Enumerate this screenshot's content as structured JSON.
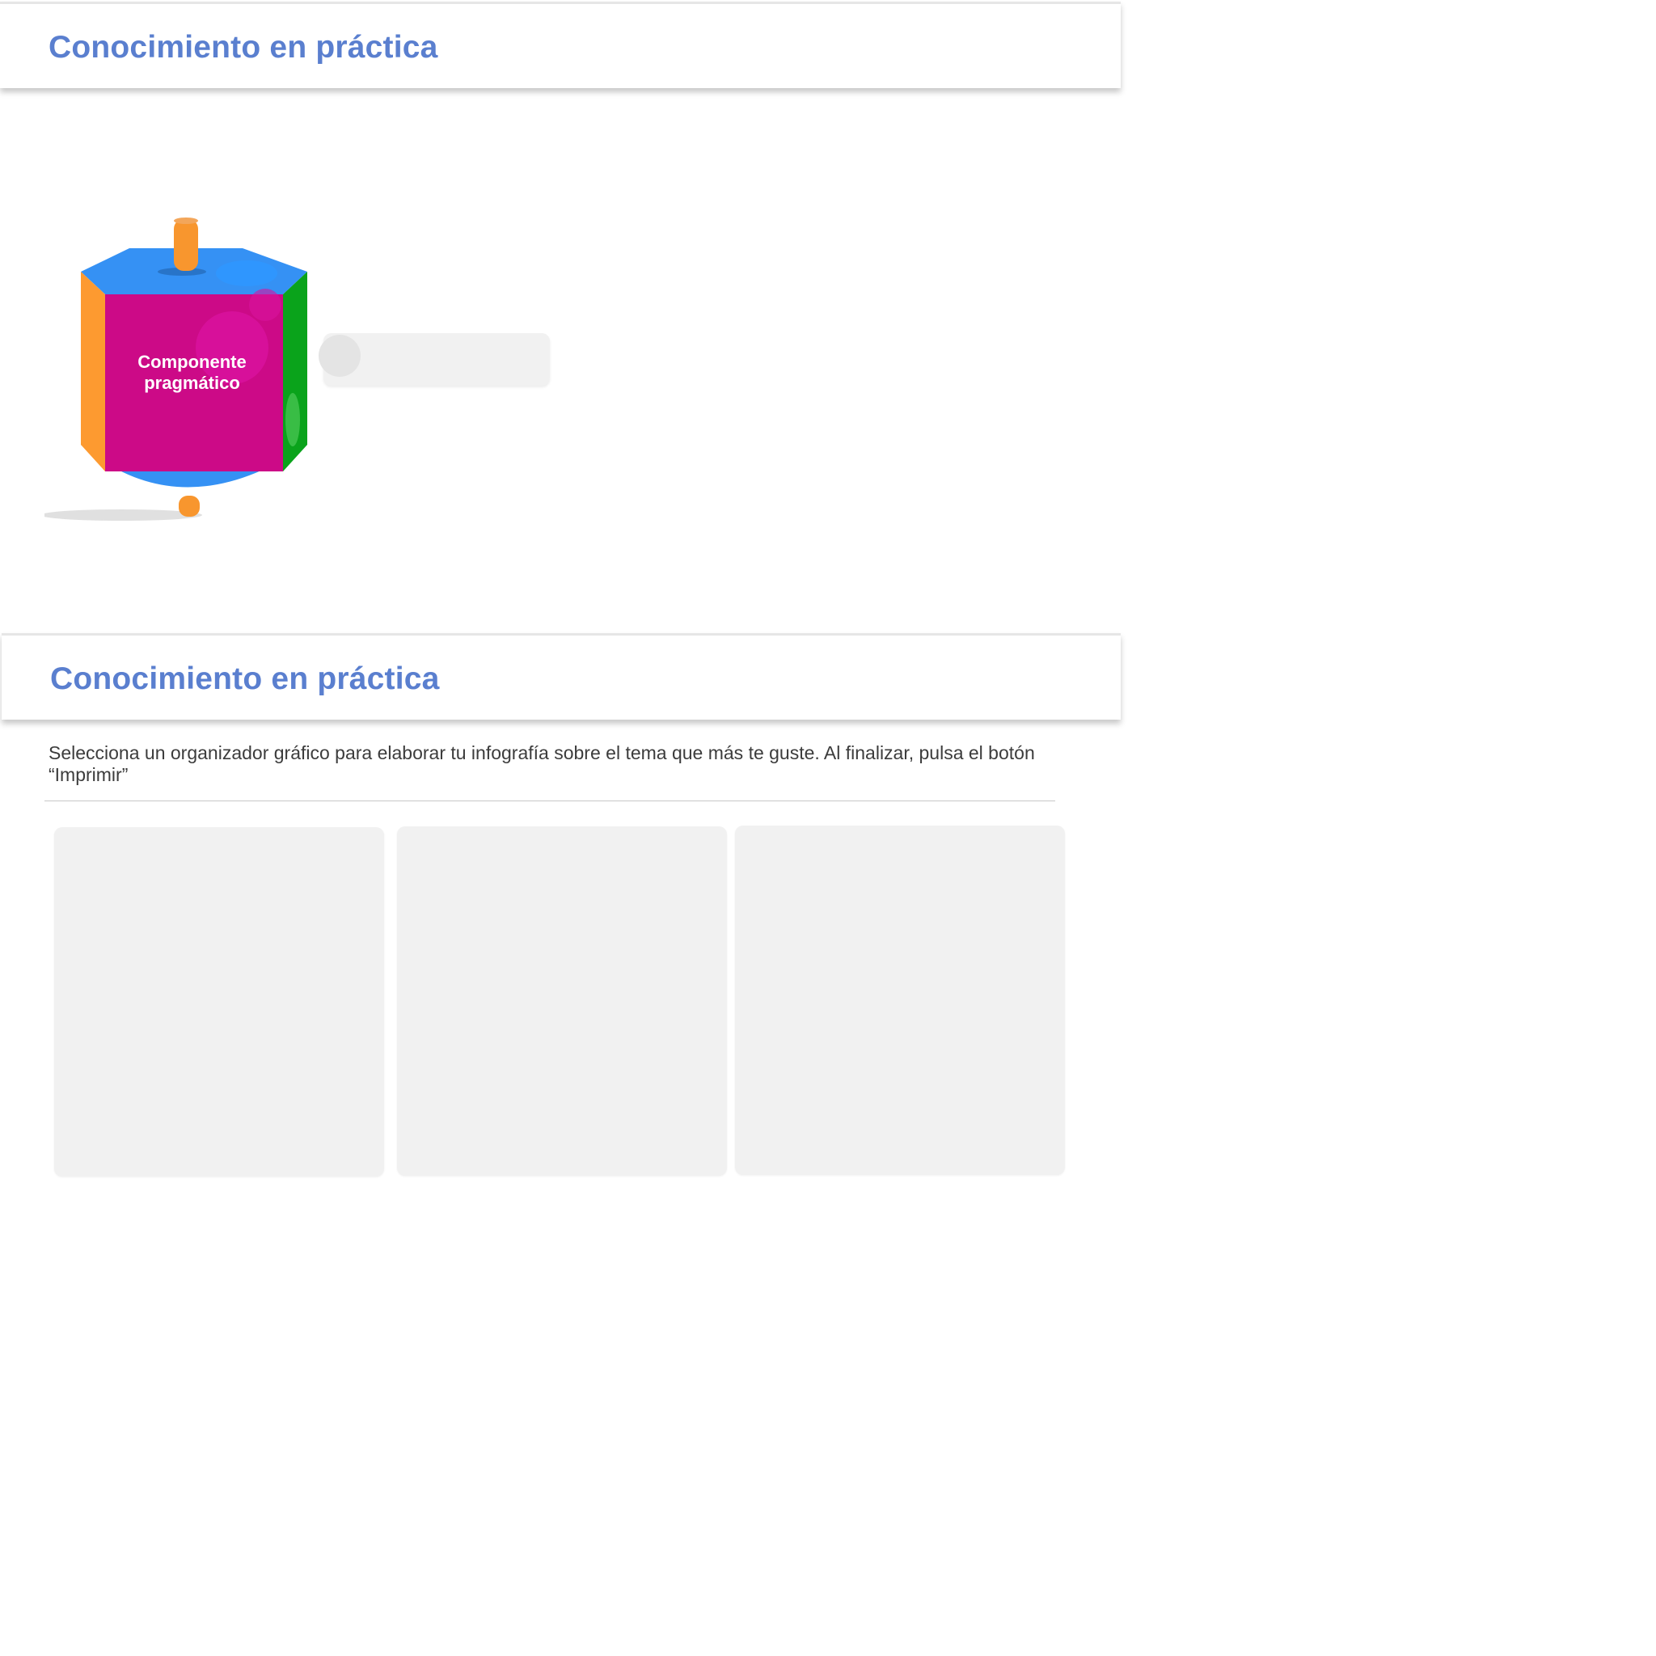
{
  "sections": [
    {
      "title": "Conocimiento en práctica"
    },
    {
      "title": "Conocimiento en práctica"
    }
  ],
  "spinning_top": {
    "label": "Componente pragmático",
    "colors": {
      "top": "#3591f4",
      "front": "#cc0a87",
      "left": "#fd9a30",
      "right": "#0aa31b",
      "handle": "#f8962e"
    }
  },
  "activity": {
    "instructions": "Selecciona un organizador gráfico para elaborar tu infografía sobre el tema que más te guste. Al finalizar, pulsa el botón “Imprimir”",
    "cards": [
      "",
      "",
      ""
    ]
  },
  "theme": {
    "title_color": "#5a7fcf",
    "placeholder_color": "#f1f1f1"
  }
}
